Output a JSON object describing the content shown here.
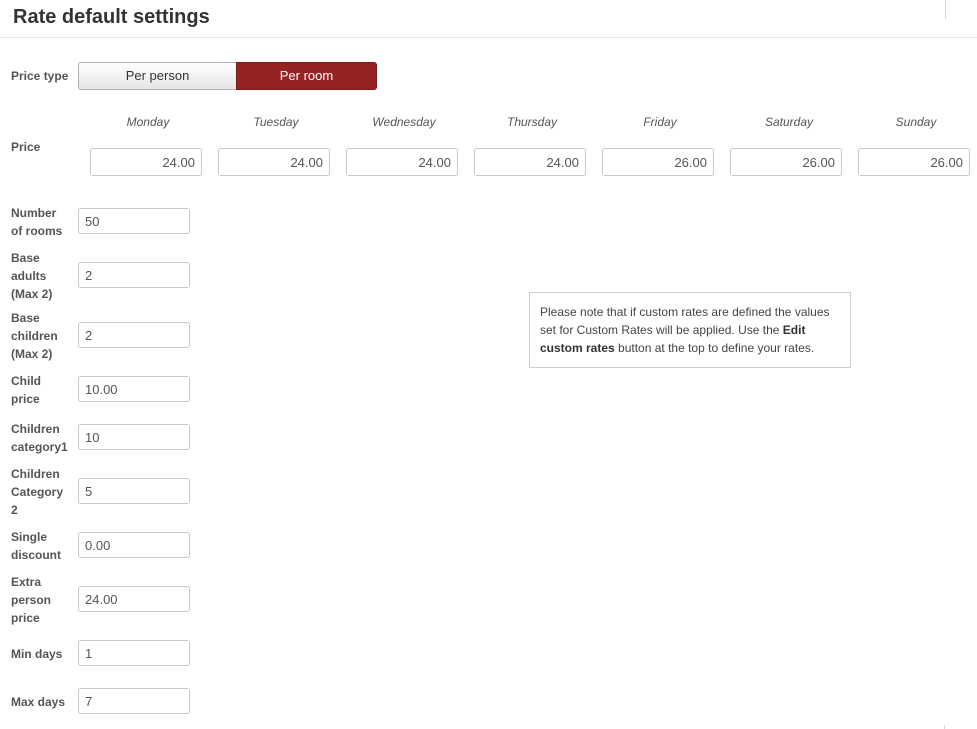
{
  "page": {
    "title": "Rate default settings"
  },
  "price_type": {
    "label": "Price type",
    "options": [
      "Per person",
      "Per room"
    ],
    "selected": "Per room"
  },
  "price": {
    "label": "Price",
    "days": [
      "Monday",
      "Tuesday",
      "Wednesday",
      "Thursday",
      "Friday",
      "Saturday",
      "Sunday"
    ],
    "values": [
      "24.00",
      "24.00",
      "24.00",
      "24.00",
      "26.00",
      "26.00",
      "26.00"
    ]
  },
  "fields": [
    {
      "label_lines": [
        "Number",
        "of rooms"
      ],
      "value": "50"
    },
    {
      "label_lines": [
        "Base",
        "adults",
        "(Max 2)"
      ],
      "value": "2"
    },
    {
      "label_lines": [
        "Base",
        "children",
        "(Max 2)"
      ],
      "value": "2"
    },
    {
      "label_lines": [
        "Child",
        "price"
      ],
      "value": "10.00"
    },
    {
      "label_lines": [
        "Children",
        "category1"
      ],
      "value": "10"
    },
    {
      "label_lines": [
        "Children",
        "Category",
        "2"
      ],
      "value": "5"
    },
    {
      "label_lines": [
        "Single",
        "discount"
      ],
      "value": "0.00"
    },
    {
      "label_lines": [
        "Extra",
        "person",
        "price"
      ],
      "value": "24.00"
    },
    {
      "label_lines": [
        "Min days"
      ],
      "value": "1"
    },
    {
      "label_lines": [
        "Max days"
      ],
      "value": "7"
    }
  ],
  "note": {
    "text_before": "Please note that if custom rates are defined the values set for Custom Rates will be applied. Use the ",
    "bold": "Edit custom rates",
    "text_after": " button at the top to define your rates."
  },
  "colors": {
    "accent": "#962323"
  }
}
